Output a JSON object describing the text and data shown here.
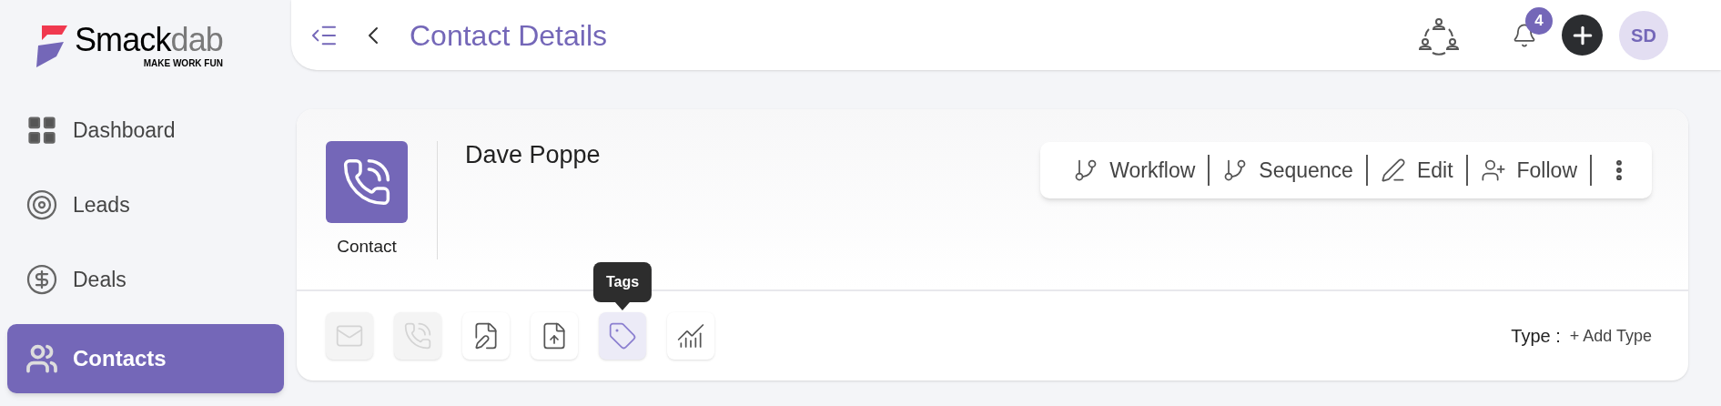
{
  "logo": {
    "name_main": "Smack",
    "name_accent": "dab",
    "tagline": "MAKE WORK FUN"
  },
  "header": {
    "title": "Contact Details",
    "notification_count": "4",
    "avatar_initials": "SD"
  },
  "sidebar": {
    "items": [
      {
        "label": "Dashboard",
        "selected": false
      },
      {
        "label": "Leads",
        "selected": false
      },
      {
        "label": "Deals",
        "selected": false
      },
      {
        "label": "Contacts",
        "selected": true
      }
    ]
  },
  "contact": {
    "name": "Dave Poppe",
    "record_type": "Contact"
  },
  "actions": [
    {
      "label": "Workflow"
    },
    {
      "label": "Sequence"
    },
    {
      "label": "Edit"
    },
    {
      "label": "Follow"
    }
  ],
  "tools": [
    {
      "disabled": true,
      "selected": false
    },
    {
      "disabled": true,
      "selected": false
    },
    {
      "disabled": false,
      "selected": false
    },
    {
      "disabled": false,
      "selected": false
    },
    {
      "disabled": false,
      "selected": true,
      "tooltip": "Tags"
    },
    {
      "disabled": false,
      "selected": false
    }
  ],
  "type_field": {
    "label": "Type :",
    "link": "+ Add Type"
  }
}
